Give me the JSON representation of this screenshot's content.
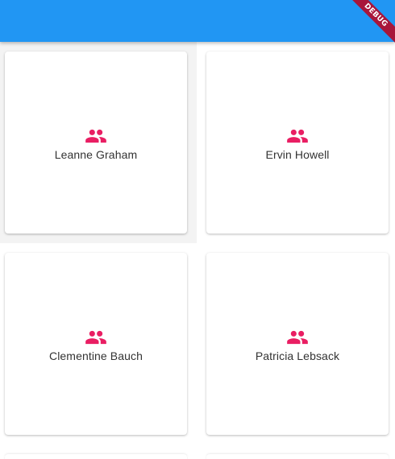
{
  "app_bar": {
    "color": "#2196f3"
  },
  "debug_banner": {
    "label": "DEBUG",
    "color": "#a8163a"
  },
  "people": [
    {
      "name": "Leanne Graham",
      "icon": "people-icon"
    },
    {
      "name": "Ervin Howell",
      "icon": "people-icon"
    },
    {
      "name": "Clementine Bauch",
      "icon": "people-icon"
    },
    {
      "name": "Patricia Lebsack",
      "icon": "people-icon"
    }
  ],
  "accent_color": "#e91e63"
}
